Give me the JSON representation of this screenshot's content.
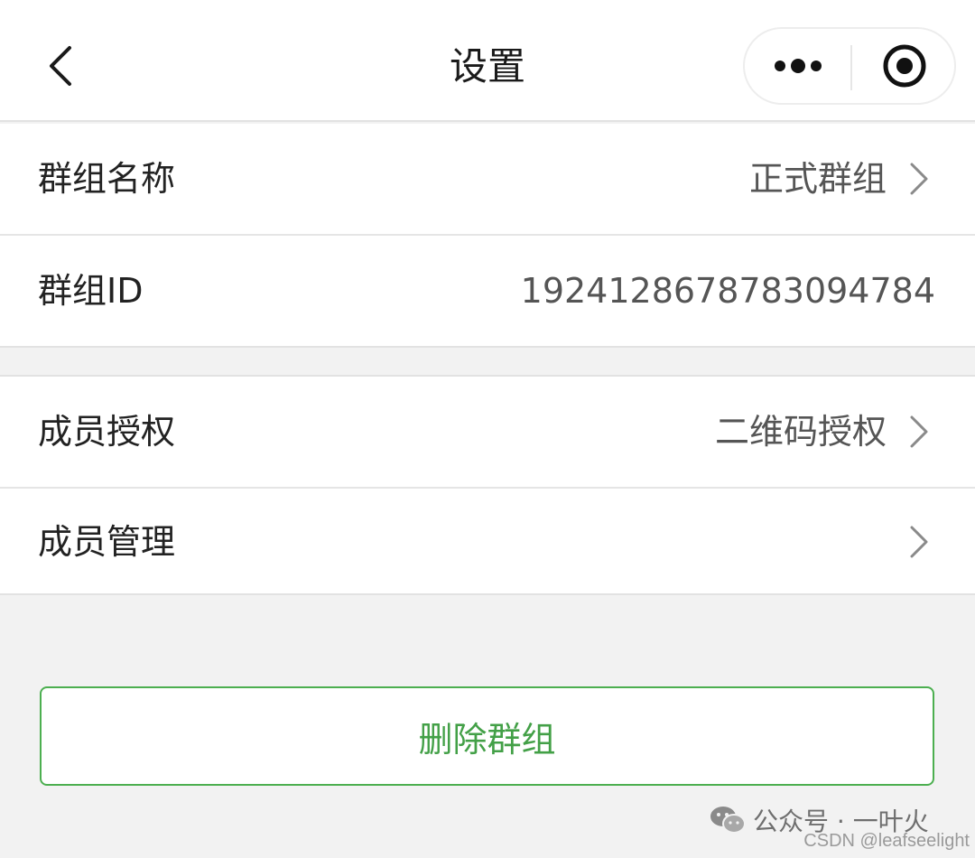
{
  "navbar": {
    "title": "设置",
    "back_icon": "chevron-left-icon",
    "menu_icon": "more-dots-icon",
    "close_icon": "target-close-icon"
  },
  "settings": {
    "group_name": {
      "label": "群组名称",
      "value": "正式群组"
    },
    "group_id": {
      "label": "群组ID",
      "value": "1924128678783094784"
    },
    "member_auth": {
      "label": "成员授权",
      "value": "二维码授权"
    },
    "member_manage": {
      "label": "成员管理",
      "value": ""
    }
  },
  "actions": {
    "delete_label": "删除群组"
  },
  "colors": {
    "accent": "#43a047",
    "border_accent": "#4caf50",
    "background": "#f2f2f2"
  },
  "watermark": {
    "wechat": "公众号 · 一叶火",
    "csdn": "CSDN @leafseelight"
  }
}
